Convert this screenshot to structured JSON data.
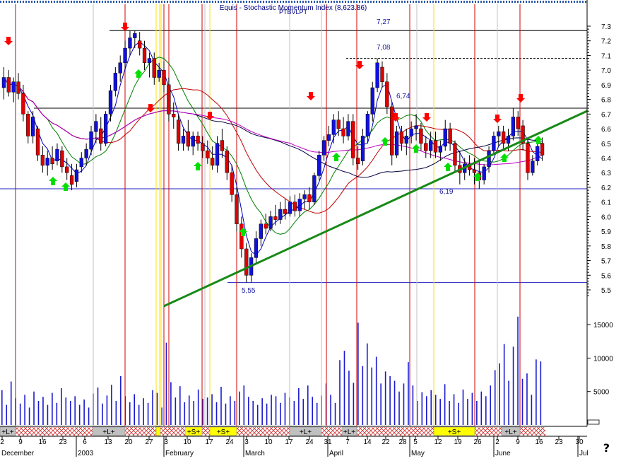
{
  "title": "Equis - Stochastic Momentum Index (8,623.86)",
  "subtitle": "PTBVLPT",
  "chart_data": {
    "type": "candlestick",
    "price_axis": {
      "min": 5.4,
      "max": 7.4,
      "ticks": [
        7.3,
        7.2,
        7.1,
        7.0,
        6.9,
        6.8,
        6.7,
        6.6,
        6.5,
        6.4,
        6.3,
        6.2,
        6.1,
        6.0,
        5.9,
        5.8,
        5.7,
        5.6,
        5.5
      ]
    },
    "volume_axis": {
      "min": 0,
      "max": 17000,
      "ticks": [
        15000,
        10000,
        5000
      ],
      "labels": [
        "15000",
        "10000",
        "5000"
      ]
    },
    "levels": [
      {
        "value": 7.27,
        "label": "7,27",
        "style": "solid"
      },
      {
        "value": 7.08,
        "label": "7,08",
        "style": "dashed"
      },
      {
        "value": 6.74,
        "label": "6,74",
        "style": "solid"
      },
      {
        "value": 6.19,
        "label": "6,19",
        "style": "solid"
      },
      {
        "value": 5.55,
        "label": "5,55",
        "style": "solid"
      }
    ],
    "trendline": {
      "from": [
        37,
        5.45
      ],
      "to": [
        130,
        6.67
      ]
    },
    "day_ticks": [
      "2",
      "9",
      "16",
      "23",
      "6",
      "13",
      "20",
      "27",
      "3",
      "10",
      "17",
      "24",
      "3",
      "10",
      "17",
      "24",
      "31",
      "7",
      "14",
      "22",
      "28",
      "5",
      "12",
      "19",
      "26",
      "2",
      "9",
      "16",
      "23",
      "30"
    ],
    "months": [
      "December",
      "2003",
      "February",
      "March",
      "April",
      "May",
      "June",
      "Jul"
    ],
    "signal_strip": [
      "+L+",
      "+L+",
      "+S+",
      "+S+",
      "+L+",
      "+L+",
      "+S+",
      "+L+"
    ],
    "candles": [
      {
        "o": 6.88,
        "h": 7.02,
        "l": 6.8,
        "c": 6.95
      },
      {
        "o": 6.95,
        "h": 7.0,
        "l": 6.82,
        "c": 6.85
      },
      {
        "o": 6.85,
        "h": 6.95,
        "l": 6.78,
        "c": 6.92
      },
      {
        "o": 6.92,
        "h": 6.98,
        "l": 6.8,
        "c": 6.84
      },
      {
        "o": 6.84,
        "h": 6.9,
        "l": 6.65,
        "c": 6.7
      },
      {
        "o": 6.7,
        "h": 6.72,
        "l": 6.5,
        "c": 6.55
      },
      {
        "o": 6.55,
        "h": 6.72,
        "l": 6.5,
        "c": 6.68
      },
      {
        "o": 6.6,
        "h": 6.62,
        "l": 6.38,
        "c": 6.42
      },
      {
        "o": 6.42,
        "h": 6.48,
        "l": 6.3,
        "c": 6.35
      },
      {
        "o": 6.35,
        "h": 6.45,
        "l": 6.28,
        "c": 6.4
      },
      {
        "o": 6.4,
        "h": 6.48,
        "l": 6.32,
        "c": 6.36
      },
      {
        "o": 6.38,
        "h": 6.5,
        "l": 6.35,
        "c": 6.46
      },
      {
        "o": 6.45,
        "h": 6.48,
        "l": 6.3,
        "c": 6.34
      },
      {
        "o": 6.34,
        "h": 6.4,
        "l": 6.25,
        "c": 6.3
      },
      {
        "o": 6.28,
        "h": 6.36,
        "l": 6.18,
        "c": 6.22
      },
      {
        "o": 6.24,
        "h": 6.36,
        "l": 6.2,
        "c": 6.32
      },
      {
        "o": 6.34,
        "h": 6.44,
        "l": 6.3,
        "c": 6.4
      },
      {
        "o": 6.4,
        "h": 6.5,
        "l": 6.35,
        "c": 6.46
      },
      {
        "o": 6.46,
        "h": 6.62,
        "l": 6.42,
        "c": 6.58
      },
      {
        "o": 6.58,
        "h": 6.7,
        "l": 6.5,
        "c": 6.65
      },
      {
        "o": 6.6,
        "h": 6.68,
        "l": 6.45,
        "c": 6.5
      },
      {
        "o": 6.5,
        "h": 6.72,
        "l": 6.48,
        "c": 6.7
      },
      {
        "o": 6.7,
        "h": 6.9,
        "l": 6.65,
        "c": 6.86
      },
      {
        "o": 6.86,
        "h": 7.02,
        "l": 6.82,
        "c": 6.98
      },
      {
        "o": 6.98,
        "h": 7.1,
        "l": 6.92,
        "c": 7.05
      },
      {
        "o": 7.05,
        "h": 7.2,
        "l": 7.0,
        "c": 7.15
      },
      {
        "o": 7.15,
        "h": 7.27,
        "l": 7.1,
        "c": 7.22
      },
      {
        "o": 7.22,
        "h": 7.27,
        "l": 7.15,
        "c": 7.25
      },
      {
        "o": 7.2,
        "h": 7.26,
        "l": 7.1,
        "c": 7.15
      },
      {
        "o": 7.15,
        "h": 7.2,
        "l": 7.0,
        "c": 7.05
      },
      {
        "o": 7.05,
        "h": 7.12,
        "l": 6.95,
        "c": 7.08
      },
      {
        "o": 7.08,
        "h": 7.12,
        "l": 6.9,
        "c": 6.95
      },
      {
        "o": 6.95,
        "h": 7.05,
        "l": 6.92,
        "c": 7.0
      },
      {
        "o": 7.0,
        "h": 7.06,
        "l": 6.85,
        "c": 6.9
      },
      {
        "o": 6.9,
        "h": 6.95,
        "l": 6.65,
        "c": 6.7
      },
      {
        "o": 6.7,
        "h": 6.78,
        "l": 6.6,
        "c": 6.68
      },
      {
        "o": 6.66,
        "h": 6.7,
        "l": 6.45,
        "c": 6.5
      },
      {
        "o": 6.5,
        "h": 6.6,
        "l": 6.45,
        "c": 6.55
      },
      {
        "o": 6.58,
        "h": 6.66,
        "l": 6.45,
        "c": 6.48
      },
      {
        "o": 6.48,
        "h": 6.58,
        "l": 6.42,
        "c": 6.55
      },
      {
        "o": 6.55,
        "h": 6.58,
        "l": 6.45,
        "c": 6.5
      },
      {
        "o": 6.5,
        "h": 6.55,
        "l": 6.4,
        "c": 6.45
      },
      {
        "o": 6.45,
        "h": 6.52,
        "l": 6.36,
        "c": 6.4
      },
      {
        "o": 6.4,
        "h": 6.48,
        "l": 6.32,
        "c": 6.35
      },
      {
        "o": 6.35,
        "h": 6.55,
        "l": 6.3,
        "c": 6.5
      },
      {
        "o": 6.52,
        "h": 6.6,
        "l": 6.4,
        "c": 6.45
      },
      {
        "o": 6.45,
        "h": 6.48,
        "l": 6.25,
        "c": 6.3
      },
      {
        "o": 6.3,
        "h": 6.35,
        "l": 6.1,
        "c": 6.15
      },
      {
        "o": 6.15,
        "h": 6.2,
        "l": 5.9,
        "c": 5.95
      },
      {
        "o": 5.95,
        "h": 6.0,
        "l": 5.72,
        "c": 5.78
      },
      {
        "o": 5.78,
        "h": 5.82,
        "l": 5.55,
        "c": 5.6
      },
      {
        "o": 5.6,
        "h": 5.75,
        "l": 5.55,
        "c": 5.72
      },
      {
        "o": 5.72,
        "h": 5.9,
        "l": 5.68,
        "c": 5.85
      },
      {
        "o": 5.85,
        "h": 5.98,
        "l": 5.8,
        "c": 5.95
      },
      {
        "o": 5.95,
        "h": 6.02,
        "l": 5.88,
        "c": 5.92
      },
      {
        "o": 5.92,
        "h": 6.04,
        "l": 5.9,
        "c": 6.0
      },
      {
        "o": 6.0,
        "h": 6.08,
        "l": 5.94,
        "c": 5.98
      },
      {
        "o": 5.98,
        "h": 6.1,
        "l": 5.95,
        "c": 6.05
      },
      {
        "o": 6.05,
        "h": 6.12,
        "l": 5.98,
        "c": 6.02
      },
      {
        "o": 6.02,
        "h": 6.14,
        "l": 6.0,
        "c": 6.1
      },
      {
        "o": 6.1,
        "h": 6.15,
        "l": 6.0,
        "c": 6.04
      },
      {
        "o": 6.04,
        "h": 6.16,
        "l": 6.0,
        "c": 6.12
      },
      {
        "o": 6.12,
        "h": 6.18,
        "l": 6.05,
        "c": 6.15
      },
      {
        "o": 6.15,
        "h": 6.2,
        "l": 6.05,
        "c": 6.1
      },
      {
        "o": 6.1,
        "h": 6.3,
        "l": 6.08,
        "c": 6.28
      },
      {
        "o": 6.28,
        "h": 6.45,
        "l": 6.25,
        "c": 6.42
      },
      {
        "o": 6.42,
        "h": 6.55,
        "l": 6.38,
        "c": 6.52
      },
      {
        "o": 6.52,
        "h": 6.62,
        "l": 6.48,
        "c": 6.56
      },
      {
        "o": 6.56,
        "h": 6.7,
        "l": 6.5,
        "c": 6.66
      },
      {
        "o": 6.66,
        "h": 6.72,
        "l": 6.55,
        "c": 6.6
      },
      {
        "o": 6.6,
        "h": 6.68,
        "l": 6.5,
        "c": 6.55
      },
      {
        "o": 6.55,
        "h": 6.7,
        "l": 6.52,
        "c": 6.65
      },
      {
        "o": 6.65,
        "h": 6.7,
        "l": 6.35,
        "c": 6.4
      },
      {
        "o": 6.4,
        "h": 6.48,
        "l": 6.32,
        "c": 6.36
      },
      {
        "o": 6.38,
        "h": 6.6,
        "l": 6.35,
        "c": 6.55
      },
      {
        "o": 6.55,
        "h": 6.72,
        "l": 6.5,
        "c": 6.7
      },
      {
        "o": 6.7,
        "h": 6.92,
        "l": 6.65,
        "c": 6.88
      },
      {
        "o": 6.88,
        "h": 7.08,
        "l": 6.85,
        "c": 7.05
      },
      {
        "o": 7.02,
        "h": 7.06,
        "l": 6.88,
        "c": 6.92
      },
      {
        "o": 6.92,
        "h": 6.98,
        "l": 6.7,
        "c": 6.75
      },
      {
        "o": 6.75,
        "h": 6.78,
        "l": 6.35,
        "c": 6.42
      },
      {
        "o": 6.42,
        "h": 6.62,
        "l": 6.4,
        "c": 6.58
      },
      {
        "o": 6.58,
        "h": 6.62,
        "l": 6.45,
        "c": 6.5
      },
      {
        "o": 6.5,
        "h": 6.6,
        "l": 6.42,
        "c": 6.55
      },
      {
        "o": 6.55,
        "h": 6.65,
        "l": 6.5,
        "c": 6.6
      },
      {
        "o": 6.6,
        "h": 6.7,
        "l": 6.52,
        "c": 6.62
      },
      {
        "o": 6.6,
        "h": 6.64,
        "l": 6.45,
        "c": 6.5
      },
      {
        "o": 6.5,
        "h": 6.55,
        "l": 6.4,
        "c": 6.45
      },
      {
        "o": 6.45,
        "h": 6.58,
        "l": 6.4,
        "c": 6.52
      },
      {
        "o": 6.52,
        "h": 6.58,
        "l": 6.4,
        "c": 6.44
      },
      {
        "o": 6.44,
        "h": 6.52,
        "l": 6.38,
        "c": 6.48
      },
      {
        "o": 6.48,
        "h": 6.66,
        "l": 6.45,
        "c": 6.6
      },
      {
        "o": 6.6,
        "h": 6.64,
        "l": 6.45,
        "c": 6.5
      },
      {
        "o": 6.5,
        "h": 6.52,
        "l": 6.3,
        "c": 6.35
      },
      {
        "o": 6.35,
        "h": 6.45,
        "l": 6.22,
        "c": 6.3
      },
      {
        "o": 6.3,
        "h": 6.4,
        "l": 6.25,
        "c": 6.36
      },
      {
        "o": 6.36,
        "h": 6.42,
        "l": 6.28,
        "c": 6.32
      },
      {
        "o": 6.32,
        "h": 6.4,
        "l": 6.22,
        "c": 6.3
      },
      {
        "o": 6.3,
        "h": 6.38,
        "l": 6.19,
        "c": 6.25
      },
      {
        "o": 6.25,
        "h": 6.36,
        "l": 6.22,
        "c": 6.34
      },
      {
        "o": 6.34,
        "h": 6.48,
        "l": 6.3,
        "c": 6.45
      },
      {
        "o": 6.45,
        "h": 6.58,
        "l": 6.42,
        "c": 6.55
      },
      {
        "o": 6.55,
        "h": 6.62,
        "l": 6.48,
        "c": 6.58
      },
      {
        "o": 6.58,
        "h": 6.62,
        "l": 6.45,
        "c": 6.5
      },
      {
        "o": 6.5,
        "h": 6.6,
        "l": 6.45,
        "c": 6.55
      },
      {
        "o": 6.55,
        "h": 6.74,
        "l": 6.52,
        "c": 6.68
      },
      {
        "o": 6.68,
        "h": 6.72,
        "l": 6.55,
        "c": 6.6
      },
      {
        "o": 6.62,
        "h": 6.66,
        "l": 6.45,
        "c": 6.5
      },
      {
        "o": 6.5,
        "h": 6.52,
        "l": 6.25,
        "c": 6.3
      },
      {
        "o": 6.3,
        "h": 6.42,
        "l": 6.28,
        "c": 6.38
      },
      {
        "o": 6.38,
        "h": 6.52,
        "l": 6.35,
        "c": 6.48
      },
      {
        "o": 6.5,
        "h": 6.54,
        "l": 6.38,
        "c": 6.42
      }
    ],
    "volumes": [
      5200,
      3000,
      6500,
      4000,
      3200,
      4500,
      2600,
      5000,
      3600,
      4200,
      3000,
      4800,
      3300,
      5500,
      4100,
      3600,
      4300,
      3000,
      3800,
      2600,
      4700,
      5600,
      3200,
      4400,
      6000,
      3600,
      7300,
      4300,
      3400,
      4600,
      3000,
      4000,
      3300,
      5200,
      4800,
      2600,
      12300,
      6400,
      4100,
      5800,
      3400,
      4400,
      3600,
      5300,
      3900,
      4100,
      4600,
      3400,
      5700,
      3200,
      4300,
      3600,
      5000,
      5900,
      4200,
      3600,
      3000,
      4000,
      3200,
      4500,
      4300,
      3300,
      4800,
      4100,
      3600,
      5500,
      3900,
      5900,
      4200,
      3300,
      4400,
      6200,
      4500,
      3300,
      9700,
      11100,
      8100,
      6300,
      15300,
      8800,
      12200,
      8600,
      10200,
      6200,
      8000,
      7300,
      6600,
      5000,
      6200,
      9400,
      5900,
      3600,
      4900,
      4300,
      5200,
      4500,
      3900,
      6100,
      3600,
      4600,
      3300,
      5300,
      3900,
      4800,
      3600,
      5000,
      4300,
      5900,
      8200,
      9200,
      12100,
      6600,
      11700,
      16200,
      6900,
      7700,
      4500,
      9800,
      9500
    ]
  },
  "markers": {
    "sell": [
      4,
      39,
      65,
      93,
      96,
      105,
      112,
      120,
      130
    ],
    "buy": [
      14,
      17,
      43,
      62,
      75,
      94,
      114,
      120,
      124,
      131,
      145,
      157,
      164,
      171
    ],
    "labels": [
      "7,27",
      "7,08",
      "6,74",
      "6,19",
      "5,55"
    ]
  }
}
